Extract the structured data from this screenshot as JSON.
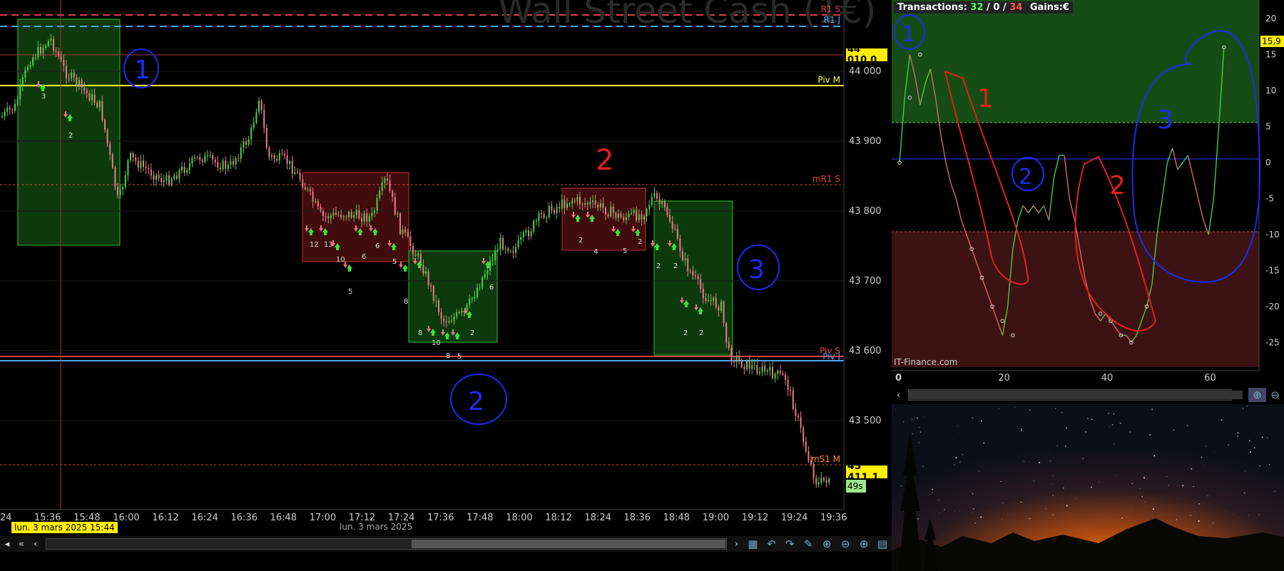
{
  "main": {
    "watermark": "Wall Street Cash (1€)",
    "y_ticks": [
      "44 000",
      "43 900",
      "43 800",
      "43 700",
      "43 600",
      "43 500"
    ],
    "x_ticks": [
      "24",
      "15:36",
      "15:48",
      "16:00",
      "16:12",
      "16:24",
      "16:36",
      "16:48",
      "17:00",
      "17:12",
      "17:24",
      "17:36",
      "17:48",
      "18:00",
      "18:12",
      "18:24",
      "18:36",
      "18:48",
      "19:00",
      "19:12",
      "19:24",
      "19:36"
    ],
    "cursor_date": "lun. 3 mars 2025 15:44",
    "axis_date": "lun. 3 mars 2025",
    "pivot_labels": {
      "r1s": "R1 S",
      "r1j": "R1 J",
      "pivm": "Piv M",
      "mr1s": "mR1 S",
      "pivs": "Piv S",
      "pivj": "Piv J",
      "ms1m": "mS1 M"
    },
    "price_top_tag": "44 010,0",
    "price_current_tag": "43 411,1",
    "timer_tag": "49s",
    "order_counts": [
      "3",
      "2",
      "12",
      "13",
      "10",
      "6",
      "6",
      "5",
      "5",
      "8",
      "8",
      "10",
      "8",
      "5",
      "2",
      "6",
      "2",
      "4",
      "5",
      "2",
      "2",
      "2",
      "2",
      "2"
    ],
    "annotations": {
      "a1": "1",
      "a2": "2",
      "a2b": "2",
      "a3": "3"
    },
    "colors": {
      "up": "#4cd24c",
      "down": "#e87a8a",
      "green_zone": "#1f8a1f",
      "red_zone": "#a82020",
      "pivot_yellow": "#ffff33",
      "pivot_red": "#e04040",
      "pivot_blue": "#4aa8ff"
    }
  },
  "perf": {
    "header_label": "Transactions:",
    "win": "32",
    "sep1": "/",
    "draw": "0",
    "sep2": "/",
    "loss": "34",
    "gains_label": "Gains:€",
    "y_ticks": [
      "20",
      "15",
      "10",
      "5",
      "0",
      "-5",
      "-10",
      "-15",
      "-20",
      "-25"
    ],
    "x_ticks": [
      "0",
      "20",
      "40",
      "60"
    ],
    "current_value_tag": "15,9",
    "credit": "IT-Finance.com",
    "annotations": {
      "a1": "1",
      "a1r": "1",
      "a2": "2",
      "a2r": "2",
      "a3": "3"
    }
  }
}
